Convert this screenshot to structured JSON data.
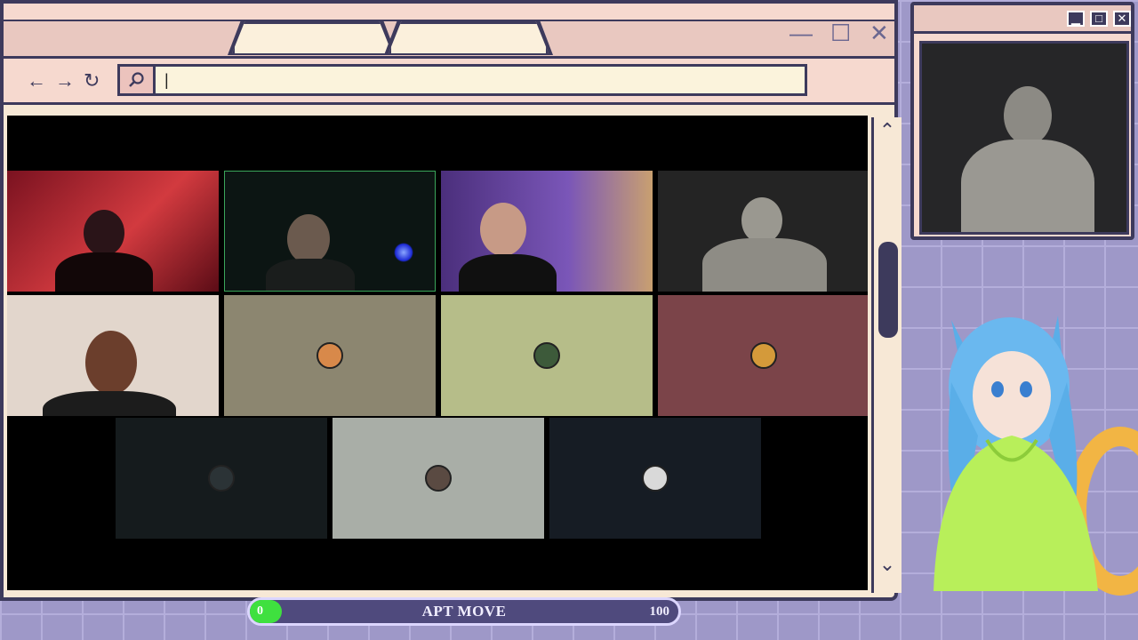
{
  "browser": {
    "tabs": [
      "",
      ""
    ],
    "nav": {
      "back": "←",
      "forward": "→",
      "reload": "↻"
    },
    "url": {
      "value": "|",
      "placeholder": ""
    },
    "window_controls": {
      "minimize": "—",
      "maximize": "☐",
      "close": "✕"
    }
  },
  "call": {
    "participants": [
      {
        "type": "video",
        "bg": "#b1262f"
      },
      {
        "type": "video",
        "bg": "#0e1714"
      },
      {
        "type": "video",
        "bg": "#5a3f8a"
      },
      {
        "type": "video",
        "bg": "#2a2a2a"
      },
      {
        "type": "video",
        "bg": "#dcccc0"
      },
      {
        "type": "avatar",
        "bg": "#8c8670"
      },
      {
        "type": "avatar",
        "bg": "#b6bd89"
      },
      {
        "type": "avatar",
        "bg": "#7b4449"
      },
      {
        "type": "avatar",
        "bg": "#151b1d"
      },
      {
        "type": "avatar",
        "bg": "#a9aea7"
      },
      {
        "type": "avatar",
        "bg": "#161c24"
      }
    ]
  },
  "facecam": {
    "controls": {
      "minimize": "▁",
      "maximize": "□",
      "close": "✕"
    }
  },
  "progress": {
    "label": "APT MOVE",
    "min_label": "0",
    "max_label": "100",
    "value": 0,
    "fill_color": "#3fe03f"
  },
  "scrollbar": {
    "up": "⌃",
    "down": "⌄"
  },
  "colors": {
    "frame": "#3d3a5c",
    "accent": "#e9c8c0"
  }
}
